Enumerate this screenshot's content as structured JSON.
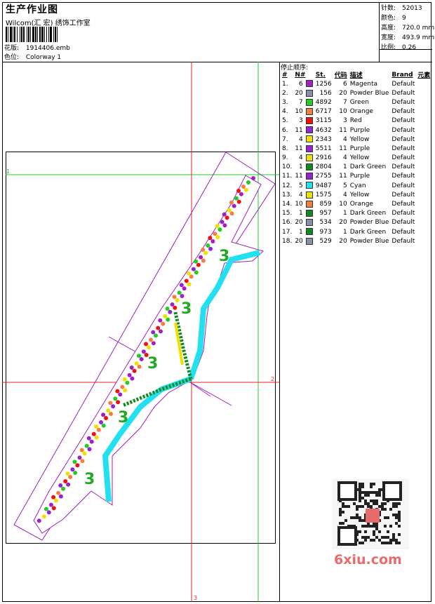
{
  "header": {
    "title": "生产作业图",
    "company": "Wilcom(汇 宏) 绣饰工作室",
    "design_label": "花版:",
    "design_file": "1914406.emb",
    "colorway_label": "色位:",
    "colorway": "Colorway 1"
  },
  "stats": [
    {
      "label": "针数:",
      "value": "52013"
    },
    {
      "label": "颜色:",
      "value": "9"
    },
    {
      "label": "高度:",
      "value": "720.0 mm"
    },
    {
      "label": "宽度:",
      "value": "493.9 mm"
    },
    {
      "label": "比例:",
      "value": "0.26"
    }
  ],
  "color_panel": {
    "title": "停止顺序:",
    "columns": [
      "#",
      "N#",
      "St.",
      "代码",
      "描述",
      "Brand",
      "元素"
    ],
    "rows": [
      {
        "idx": "1.",
        "n": "6",
        "color": "#a020c0",
        "st": "1256",
        "code": "6",
        "desc": "Magenta",
        "brand": "Default"
      },
      {
        "idx": "2.",
        "n": "20",
        "color": "#8890a8",
        "st": "156",
        "code": "20",
        "desc": "Powder Blue",
        "brand": "Default"
      },
      {
        "idx": "3.",
        "n": "7",
        "color": "#22cc22",
        "st": "4892",
        "code": "7",
        "desc": "Green",
        "brand": "Default"
      },
      {
        "idx": "4.",
        "n": "10",
        "color": "#f08040",
        "st": "6717",
        "code": "10",
        "desc": "Orange",
        "brand": "Default"
      },
      {
        "idx": "5.",
        "n": "3",
        "color": "#ee1111",
        "st": "3115",
        "code": "3",
        "desc": "Red",
        "brand": "Default"
      },
      {
        "idx": "6.",
        "n": "11",
        "color": "#9922cc",
        "st": "4632",
        "code": "11",
        "desc": "Purple",
        "brand": "Default"
      },
      {
        "idx": "7.",
        "n": "4",
        "color": "#f0e000",
        "st": "2343",
        "code": "4",
        "desc": "Yellow",
        "brand": "Default"
      },
      {
        "idx": "8.",
        "n": "11",
        "color": "#9922cc",
        "st": "5511",
        "code": "11",
        "desc": "Purple",
        "brand": "Default"
      },
      {
        "idx": "9.",
        "n": "4",
        "color": "#f0e000",
        "st": "2916",
        "code": "4",
        "desc": "Yellow",
        "brand": "Default"
      },
      {
        "idx": "10.",
        "n": "1",
        "color": "#118822",
        "st": "2804",
        "code": "1",
        "desc": "Dark Green",
        "brand": "Default"
      },
      {
        "idx": "11.",
        "n": "11",
        "color": "#9922cc",
        "st": "2755",
        "code": "11",
        "desc": "Purple",
        "brand": "Default"
      },
      {
        "idx": "12.",
        "n": "5",
        "color": "#22e0f0",
        "st": "9487",
        "code": "5",
        "desc": "Cyan",
        "brand": "Default"
      },
      {
        "idx": "13.",
        "n": "4",
        "color": "#f0e000",
        "st": "1575",
        "code": "4",
        "desc": "Yellow",
        "brand": "Default"
      },
      {
        "idx": "14.",
        "n": "10",
        "color": "#f08040",
        "st": "859",
        "code": "10",
        "desc": "Orange",
        "brand": "Default"
      },
      {
        "idx": "15.",
        "n": "1",
        "color": "#118822",
        "st": "957",
        "code": "1",
        "desc": "Dark Green",
        "brand": "Default"
      },
      {
        "idx": "16.",
        "n": "20",
        "color": "#8890a8",
        "st": "534",
        "code": "20",
        "desc": "Powder Blue",
        "brand": "Default"
      },
      {
        "idx": "17.",
        "n": "1",
        "color": "#118822",
        "st": "973",
        "code": "1",
        "desc": "Dark Green",
        "brand": "Default"
      },
      {
        "idx": "18.",
        "n": "20",
        "color": "#8890a8",
        "st": "529",
        "code": "20",
        "desc": "Powder Blue",
        "brand": "Default"
      }
    ]
  },
  "guides": {
    "marker_1": "1",
    "marker_2": "2",
    "marker_3": "3"
  },
  "watermark": "6xiu.com"
}
